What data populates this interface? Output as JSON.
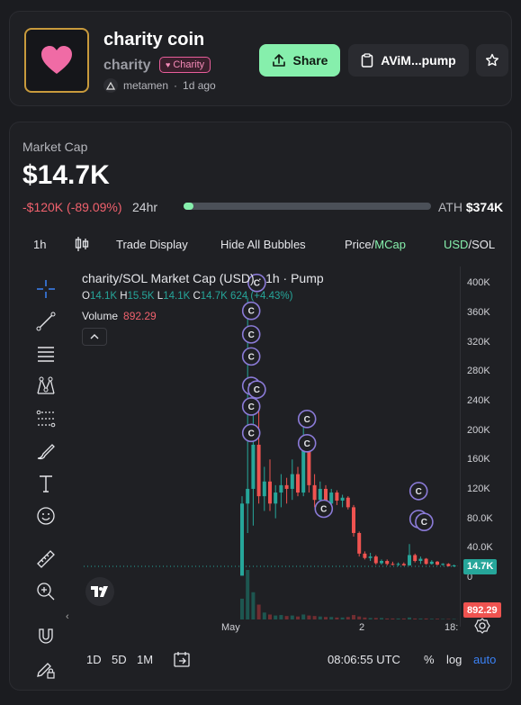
{
  "coin": {
    "name": "charity coin",
    "ticker": "charity",
    "tag": "Charity",
    "creator": "metamen",
    "created_ago": "1d ago",
    "avatar_icon": "heart-icon"
  },
  "actions": {
    "share_label": "Share",
    "address_label": "AViM...pump"
  },
  "market_cap": {
    "label": "Market Cap",
    "value": "$14.7K",
    "change": "-$120K (-89.09%)",
    "period": "24hr",
    "ath_label": "ATH",
    "ath_value": "$374K",
    "ath_progress_percent": 3.9
  },
  "chart_toolbar": {
    "interval": "1h",
    "trade_display": "Trade Display",
    "hide_bubbles": "Hide All Bubbles",
    "price_label": "Price",
    "mcap_label": "MCap",
    "usd_label": "USD",
    "sol_label": "SOL"
  },
  "legend": {
    "title": "charity/SOL Market Cap (USD) · 1h · Pump",
    "o_label": "O",
    "o": "14.1K",
    "h_label": "H",
    "h": "15.5K",
    "l_label": "L",
    "l": "14.1K",
    "c_label": "C",
    "c": "14.7K",
    "change": "624 (+4.43%)",
    "volume_label": "Volume",
    "volume_value": "892.29"
  },
  "y_axis": {
    "ticks": [
      "400K",
      "360K",
      "320K",
      "280K",
      "240K",
      "200K",
      "160K",
      "120K",
      "80.0K",
      "40.0K",
      "0"
    ],
    "last_value": "14.7K",
    "last_volume": "892.29"
  },
  "x_axis": {
    "ticks": [
      "May",
      "2",
      "18:"
    ]
  },
  "bottom": {
    "ranges": [
      "1D",
      "5D",
      "1M"
    ],
    "time": "08:06:55 UTC",
    "percent": "%",
    "log": "log",
    "auto": "auto"
  },
  "colors": {
    "up": "#26a69a",
    "down": "#ef5350",
    "accent_green": "#86efac",
    "blue": "#3b82f6",
    "bubble": "#8b7bd8"
  },
  "chart_data": {
    "type": "candlestick",
    "title": "charity/SOL Market Cap (USD) · 1h · Pump",
    "ylim": [
      0,
      410000
    ],
    "x_labels": [
      "May",
      "2",
      "18:"
    ],
    "candles": [
      {
        "o": 2000,
        "h": 110000,
        "l": 2000,
        "c": 100000
      },
      {
        "o": 100000,
        "h": 380000,
        "l": 60000,
        "c": 120000
      },
      {
        "o": 120000,
        "h": 260000,
        "l": 70000,
        "c": 180000
      },
      {
        "o": 180000,
        "h": 230000,
        "l": 100000,
        "c": 110000
      },
      {
        "o": 110000,
        "h": 150000,
        "l": 90000,
        "c": 130000
      },
      {
        "o": 130000,
        "h": 160000,
        "l": 90000,
        "c": 100000
      },
      {
        "o": 100000,
        "h": 125000,
        "l": 80000,
        "c": 115000
      },
      {
        "o": 115000,
        "h": 140000,
        "l": 95000,
        "c": 125000
      },
      {
        "o": 125000,
        "h": 135000,
        "l": 100000,
        "c": 120000
      },
      {
        "o": 120000,
        "h": 160000,
        "l": 105000,
        "c": 140000
      },
      {
        "o": 140000,
        "h": 150000,
        "l": 110000,
        "c": 115000
      },
      {
        "o": 115000,
        "h": 210000,
        "l": 110000,
        "c": 180000
      },
      {
        "o": 180000,
        "h": 185000,
        "l": 115000,
        "c": 125000
      },
      {
        "o": 125000,
        "h": 140000,
        "l": 95000,
        "c": 105000
      },
      {
        "o": 105000,
        "h": 130000,
        "l": 100000,
        "c": 120000
      },
      {
        "o": 120000,
        "h": 125000,
        "l": 95000,
        "c": 100000
      },
      {
        "o": 100000,
        "h": 120000,
        "l": 98000,
        "c": 115000
      },
      {
        "o": 115000,
        "h": 118000,
        "l": 98000,
        "c": 104000
      },
      {
        "o": 104000,
        "h": 112000,
        "l": 95000,
        "c": 108000
      },
      {
        "o": 108000,
        "h": 110000,
        "l": 92000,
        "c": 95000
      },
      {
        "o": 95000,
        "h": 98000,
        "l": 55000,
        "c": 60000
      },
      {
        "o": 60000,
        "h": 62000,
        "l": 28000,
        "c": 32000
      },
      {
        "o": 32000,
        "h": 35000,
        "l": 24000,
        "c": 26000
      },
      {
        "o": 26000,
        "h": 33000,
        "l": 22000,
        "c": 28000
      },
      {
        "o": 28000,
        "h": 30000,
        "l": 17000,
        "c": 19000
      },
      {
        "o": 19000,
        "h": 24000,
        "l": 17000,
        "c": 22000
      },
      {
        "o": 22000,
        "h": 24000,
        "l": 16000,
        "c": 18000
      },
      {
        "o": 18000,
        "h": 21000,
        "l": 16000,
        "c": 17000
      },
      {
        "o": 17000,
        "h": 20000,
        "l": 15000,
        "c": 18000
      },
      {
        "o": 18000,
        "h": 20000,
        "l": 15500,
        "c": 16000
      },
      {
        "o": 16000,
        "h": 45000,
        "l": 15500,
        "c": 30000
      },
      {
        "o": 30000,
        "h": 32000,
        "l": 20000,
        "c": 22000
      },
      {
        "o": 22000,
        "h": 28000,
        "l": 18000,
        "c": 25000
      },
      {
        "o": 25000,
        "h": 26000,
        "l": 17000,
        "c": 18000
      },
      {
        "o": 18000,
        "h": 23000,
        "l": 17000,
        "c": 21000
      },
      {
        "o": 21000,
        "h": 22000,
        "l": 16000,
        "c": 17000
      },
      {
        "o": 17000,
        "h": 19000,
        "l": 15500,
        "c": 18000
      },
      {
        "o": 18000,
        "h": 19000,
        "l": 14500,
        "c": 15000
      },
      {
        "o": 15000,
        "h": 17000,
        "l": 14000,
        "c": 16000
      },
      {
        "o": 16000,
        "h": 16500,
        "l": 14000,
        "c": 14500
      },
      {
        "o": 14500,
        "h": 15500,
        "l": 14000,
        "c": 14800
      },
      {
        "o": 14100,
        "h": 15500,
        "l": 14100,
        "c": 14700
      }
    ],
    "volume": [
      42,
      100,
      55,
      30,
      14,
      10,
      8,
      9,
      7,
      8,
      6,
      10,
      8,
      7,
      6,
      5,
      5,
      4,
      4,
      5,
      9,
      6,
      4,
      3,
      3,
      3,
      2,
      2,
      2,
      2,
      4,
      2,
      2,
      2,
      1.5,
      1.5,
      1,
      1,
      1,
      1,
      1,
      1
    ],
    "bubbles": [
      {
        "candle": 2,
        "v": 400000
      },
      {
        "candle": 1,
        "v": 362000
      },
      {
        "candle": 1,
        "v": 330000
      },
      {
        "candle": 1,
        "v": 300000
      },
      {
        "candle": 1,
        "v": 260000
      },
      {
        "candle": 2,
        "v": 255000
      },
      {
        "candle": 1,
        "v": 232000
      },
      {
        "candle": 1,
        "v": 196000
      },
      {
        "candle": 11,
        "v": 215000
      },
      {
        "candle": 11,
        "v": 182000
      },
      {
        "candle": 14,
        "v": 93000
      },
      {
        "candle": 31,
        "v": 117000
      },
      {
        "candle": 31,
        "v": 79000
      },
      {
        "candle": 32,
        "v": 75000
      }
    ],
    "bubble_letter": "C"
  }
}
